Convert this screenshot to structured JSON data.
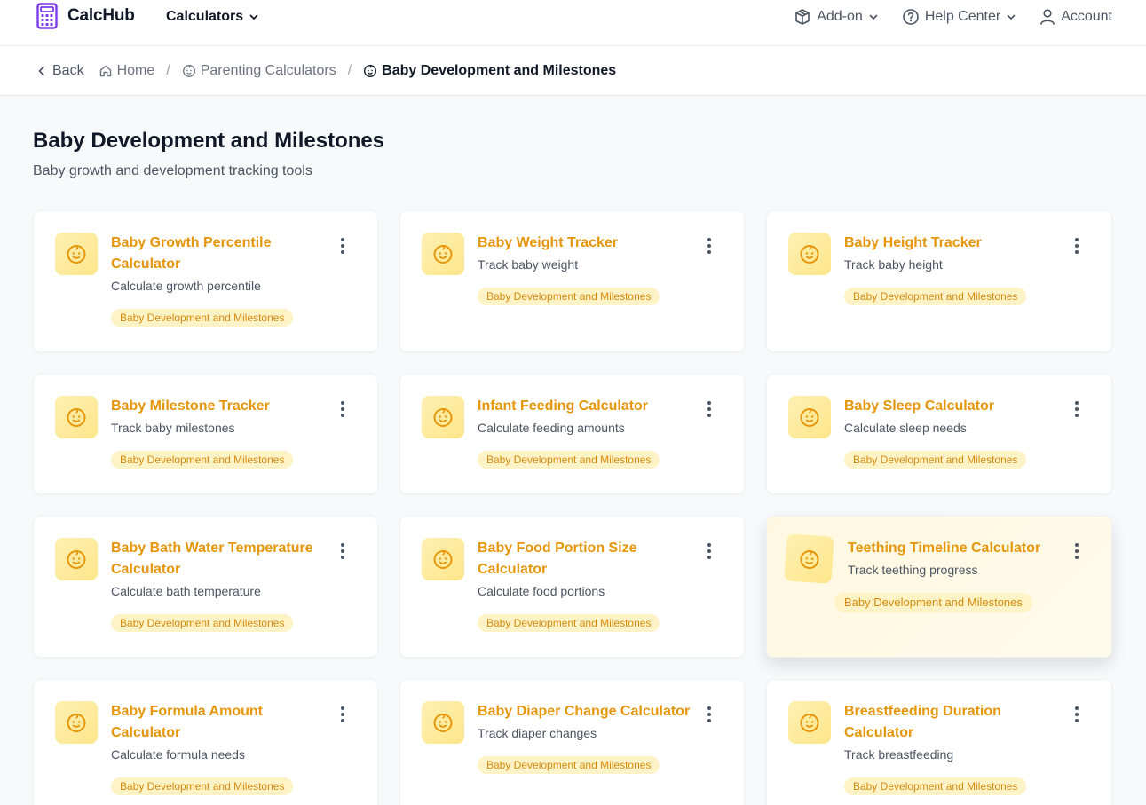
{
  "app": {
    "name": "CalcHub"
  },
  "nav": {
    "calculators": "Calculators",
    "addon": "Add-on",
    "help": "Help Center",
    "account": "Account"
  },
  "breadcrumb": {
    "back": "Back",
    "home": "Home",
    "parent": "Parenting Calculators",
    "current": "Baby Development and Milestones"
  },
  "page": {
    "title": "Baby Development and Milestones",
    "subtitle": "Baby growth and development tracking tools"
  },
  "colors": {
    "accent": "#e5960a",
    "badge_bg": "#fef3c7",
    "badge_text": "#d68a0a",
    "icon_bg": "#fde68a"
  },
  "cards": [
    {
      "title": "Baby Growth Percentile Calculator",
      "desc": "Calculate growth percentile",
      "badge": "Baby Development and Milestones",
      "icon": "baby-face-icon"
    },
    {
      "title": "Baby Weight Tracker",
      "desc": "Track baby weight",
      "badge": "Baby Development and Milestones",
      "icon": "baby-face-icon"
    },
    {
      "title": "Baby Height Tracker",
      "desc": "Track baby height",
      "badge": "Baby Development and Milestones",
      "icon": "baby-face-icon"
    },
    {
      "title": "Baby Milestone Tracker",
      "desc": "Track baby milestones",
      "badge": "Baby Development and Milestones",
      "icon": "baby-face-icon"
    },
    {
      "title": "Infant Feeding Calculator",
      "desc": "Calculate feeding amounts",
      "badge": "Baby Development and Milestones",
      "icon": "baby-face-icon"
    },
    {
      "title": "Baby Sleep Calculator",
      "desc": "Calculate sleep needs",
      "badge": "Baby Development and Milestones",
      "icon": "baby-face-icon"
    },
    {
      "title": "Baby Bath Water Temperature Calculator",
      "desc": "Calculate bath temperature",
      "badge": "Baby Development and Milestones",
      "icon": "baby-face-icon"
    },
    {
      "title": "Baby Food Portion Size Calculator",
      "desc": "Calculate food portions",
      "badge": "Baby Development and Milestones",
      "icon": "baby-face-icon"
    },
    {
      "title": "Teething Timeline Calculator",
      "desc": "Track teething progress",
      "badge": "Baby Development and Milestones",
      "icon": "baby-face-icon"
    },
    {
      "title": "Baby Formula Amount Calculator",
      "desc": "Calculate formula needs",
      "badge": "Baby Development and Milestones",
      "icon": "baby-face-icon"
    },
    {
      "title": "Baby Diaper Change Calculator",
      "desc": "Track diaper changes",
      "badge": "Baby Development and Milestones",
      "icon": "baby-face-icon"
    },
    {
      "title": "Breastfeeding Duration Calculator",
      "desc": "Track breastfeeding",
      "badge": "Baby Development and Milestones",
      "icon": "baby-face-icon"
    }
  ]
}
